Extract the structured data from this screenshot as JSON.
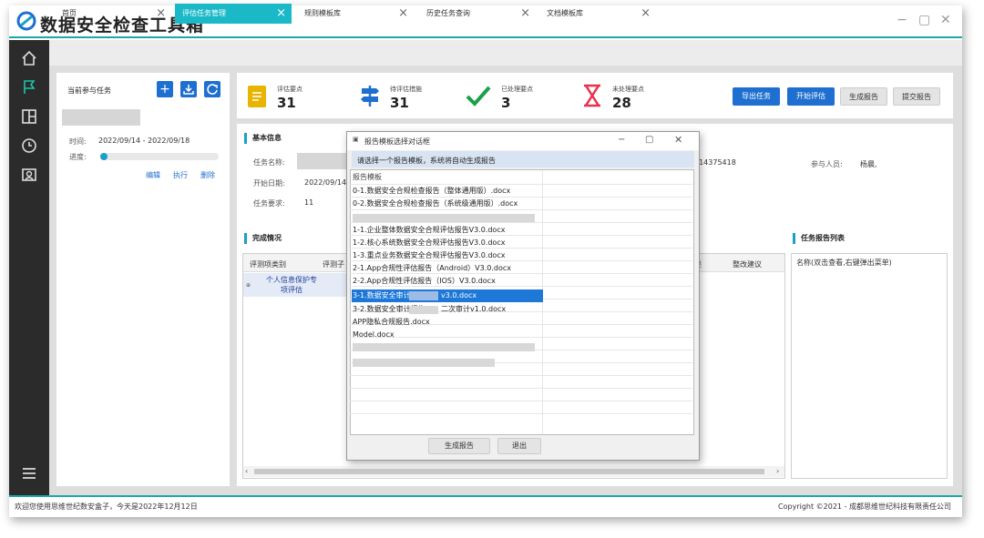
{
  "app": {
    "title": "数据安全检查工具箱"
  },
  "window_controls": {
    "minimize": "−",
    "maximize": "▢",
    "close": "✕"
  },
  "tabs": [
    {
      "label": "首页",
      "active": false
    },
    {
      "label": "评估任务管理",
      "active": true
    },
    {
      "label": "规则模板库",
      "active": false
    },
    {
      "label": "历史任务查询",
      "active": false
    },
    {
      "label": "文档模板库",
      "active": false
    }
  ],
  "left_panel": {
    "title": "当前参与任务",
    "time_label": "时间:",
    "time_value": "2022/09/14 - 2022/09/18",
    "progress_label": "进度:",
    "progress": 0.03,
    "actions": [
      "编辑",
      "执行",
      "删除"
    ]
  },
  "stats": [
    {
      "label": "评估要点",
      "value": "31",
      "icon": "document-icon",
      "color": "#e8b400"
    },
    {
      "label": "待评估措施",
      "value": "31",
      "icon": "signpost-icon",
      "color": "#1e6fd0"
    },
    {
      "label": "已处理要点",
      "value": "3",
      "icon": "checkmark-icon",
      "color": "#1aa04a"
    },
    {
      "label": "未处理要点",
      "value": "28",
      "icon": "hourglass-icon",
      "color": "#e8324a"
    }
  ],
  "toolbar": {
    "export_task": "导出任务",
    "start_eval": "开始评估",
    "gen_report": "生成报告",
    "submit_report": "提交报告"
  },
  "basic_info": {
    "title": "基本信息",
    "task_name_label": "任务名称:",
    "start_date_label": "开始日期:",
    "start_date_value": "2022/09/14",
    "task_req_label": "任务要求:",
    "task_req_value": "11",
    "phone_value": "914375418",
    "participants_label": "参与人员:",
    "participants_value": "杨晨,"
  },
  "completion": {
    "title": "完成情况",
    "columns": [
      "评测项类别",
      "评测子",
      "述",
      "整改建议"
    ],
    "row_category": "个人信息保护专项评估"
  },
  "report_list": {
    "title": "任务报告列表",
    "column": "名称(双击查看,右键弹出菜单)"
  },
  "dialog": {
    "title": "报告模板选择对话框",
    "hint": "请选择一个报告模板，系统将自动生成报告",
    "header": "报告模板",
    "items": [
      "0-1.数据安全合规检查报告（整体通用版）.docx",
      "0-2.数据安全合规检查报告（系统级通用版）.docx",
      "1-1.企业整体数据安全合规评估报告V3.0.docx",
      "1-2.核心系统数据安全合规评估报告V3.0.docx",
      "1-3.重点业务数据安全合规评估报告V3.0.docx",
      "2-1.App合规性评估报告（Android）V3.0.docx",
      "2-2.App合规性评估报告（IOS）V3.0.docx",
      "3-1.数据安全审计报告",
      "v3.0.docx",
      "3-2.数据安全审计报告",
      "二次审计v1.0.docx",
      "APP隐私合规报告.docx",
      "Model.docx"
    ],
    "generate": "生成报告",
    "exit": "退出"
  },
  "status": {
    "welcome": "欢迎您使用思维世纪数安盒子，今天是2022年12月12日",
    "copyright": "Copyright ©2021 - 成都思维世纪科技有限责任公司"
  }
}
